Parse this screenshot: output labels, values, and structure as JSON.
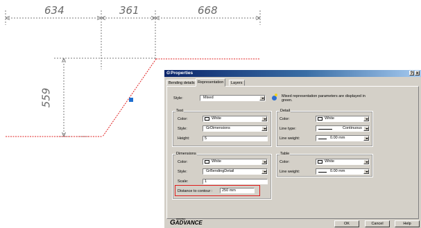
{
  "drawing": {
    "dimensions": {
      "top": [
        "634",
        "361",
        "668"
      ],
      "left": "559"
    },
    "colors": {
      "contour": "#e02020",
      "dimension_line": "#7a7a7a",
      "grip": "#1f6fd0"
    }
  },
  "dialog": {
    "title": "Properties",
    "title_buttons": [
      "?",
      "x"
    ],
    "tabs": [
      "Bending details",
      "Representation",
      "Layers"
    ],
    "active_tab": "Representation",
    "style": {
      "label": "Style:",
      "value": "Mixed"
    },
    "info_text_line1": "Mixed representation parameters are displayed in",
    "info_text_line2": "green.",
    "text_group": {
      "title": "Text",
      "color_label": "Color:",
      "color_value": "White",
      "style_label": "Style:",
      "style_value": "GrDimensions",
      "height_label": "Height:",
      "height_value": "5"
    },
    "dimensions_group": {
      "title": "Dimensions",
      "color_label": "Color:",
      "color_value": "White",
      "style_label": "Style:",
      "style_value": "GrBendingDetail",
      "scale_label": "Scale:",
      "scale_value": "1",
      "distance_label": "Distance to contour :",
      "distance_value": "250 mm"
    },
    "detail_group": {
      "title": "Detail",
      "color_label": "Color:",
      "color_value": "White",
      "linetype_label": "Line type:",
      "linetype_value": "Continuous",
      "lineweight_label": "Line weight:",
      "lineweight_value": "0.00 mm"
    },
    "table_group": {
      "title": "Table",
      "color_label": "Color:",
      "color_value": "White",
      "lineweight_label": "Line weight:",
      "lineweight_value": "0.00 mm"
    },
    "footer": {
      "brand_small": "GRAITEC",
      "brand": "ADVANCE",
      "ok": "OK",
      "cancel": "Cancel",
      "help": "Help"
    },
    "highlight_color": "#e01b1b"
  }
}
